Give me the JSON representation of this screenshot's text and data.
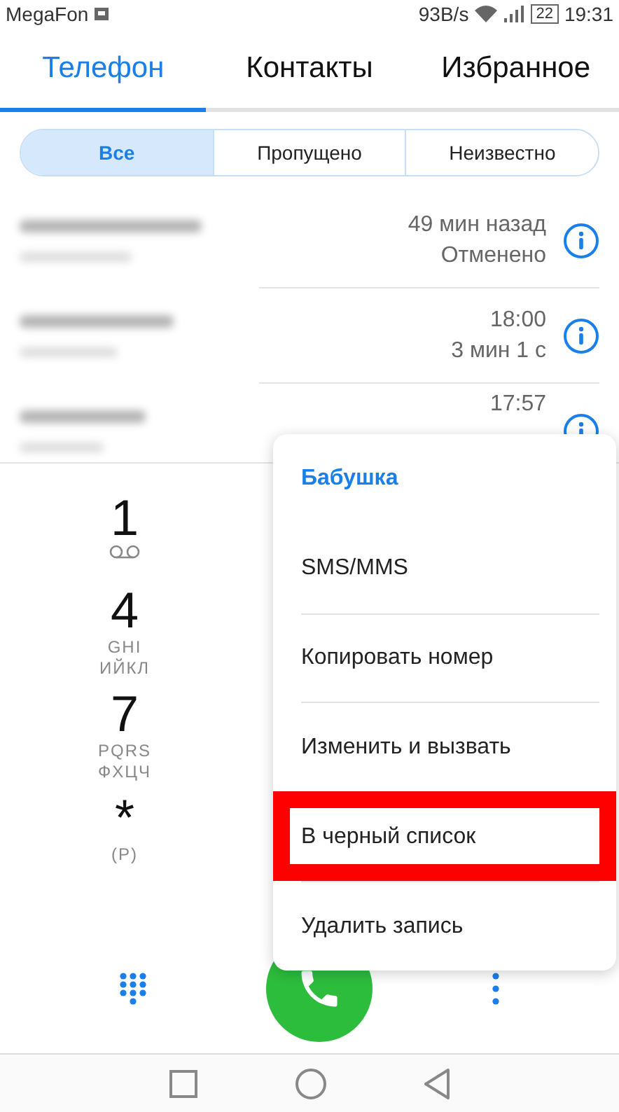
{
  "status_bar": {
    "carrier": "MegaFon",
    "speed": "93B/s",
    "battery": "22",
    "time": "19:31"
  },
  "tabs": [
    {
      "label": "Телефон",
      "selected": true
    },
    {
      "label": "Контакты",
      "selected": false
    },
    {
      "label": "Избранное",
      "selected": false
    }
  ],
  "filters": [
    {
      "label": "Все",
      "selected": true
    },
    {
      "label": "Пропущено",
      "selected": false
    },
    {
      "label": "Неизвестно",
      "selected": false
    }
  ],
  "calls": [
    {
      "time": "49 мин назад",
      "detail": "Отменено"
    },
    {
      "time": "18:00",
      "detail": "3 мин 1 с"
    },
    {
      "time": "17:57"
    }
  ],
  "dialpad": [
    {
      "digit": "1",
      "kind": "voicemail"
    },
    {
      "digit": "4",
      "kind": "letters",
      "letters": [
        "GHI",
        "ИЙКЛ"
      ]
    },
    {
      "digit": "7",
      "kind": "letters",
      "letters": [
        "PQRS",
        "ФХЦЧ"
      ]
    },
    {
      "digit": "*",
      "kind": "letters",
      "letters": [
        "(P)"
      ]
    }
  ],
  "menu": {
    "title": "Бабушка",
    "items": [
      {
        "label": "SMS/MMS",
        "highlighted": false
      },
      {
        "label": "Копировать номер",
        "highlighted": false
      },
      {
        "label": "Изменить и вызвать",
        "highlighted": false
      },
      {
        "label": "В черный список",
        "highlighted": true
      },
      {
        "label": "Удалить запись",
        "highlighted": false
      }
    ]
  }
}
